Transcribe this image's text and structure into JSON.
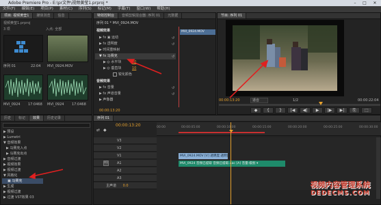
{
  "window": {
    "title": "Adobe Premiere Pro - E:\\pr文件\\视频黄莹1.prproj *",
    "buttons": [
      "–",
      "□",
      "✕"
    ]
  },
  "menu": [
    "文件(F)",
    "编辑(E)",
    "项目(P)",
    "素材(C)",
    "序列(S)",
    "标记(M)",
    "字幕(T)",
    "窗口(W)",
    "帮助(H)"
  ],
  "project": {
    "tabs": [
      "项目: 视频黄莹1",
      "媒体浏览",
      "信息",
      "效果"
    ],
    "file_name": "视频黄莹1.prproj",
    "item_count": "3 项",
    "in_point": "入点: 全部",
    "items": [
      {
        "name": "序列 01",
        "duration": "22:04"
      },
      {
        "name": "MVI_0924.MOV",
        "duration": "22:04"
      },
      {
        "name": "MVI_0924",
        "duration": "17:0468"
      },
      {
        "name": "MVI_0924",
        "duration": "17:0468"
      }
    ]
  },
  "effect_controls": {
    "tabs": [
      "特效控制台",
      "音频剪辑混合器: 序列 01",
      "元数据"
    ],
    "clip_title": "序列 01 * MVI_0924.MOV",
    "mini_clip": "MVI_0924.MOV",
    "sections": [
      {
        "label": "视频效果"
      },
      {
        "label": "▶ fx ▣ 运动"
      },
      {
        "label": "▶ fx 透明度"
      },
      {
        "label": "▶ 时间重映射"
      },
      {
        "label": "▼ fx 马赛克"
      },
      {
        "label": "▶ ◎ 水平块"
      },
      {
        "label": "▶ ◎ 垂直块"
      },
      {
        "label": "锐化颜色"
      },
      {
        "label": "音频效果"
      },
      {
        "label": "▶ fx 音量"
      },
      {
        "label": "▶ fx 声道音量"
      },
      {
        "label": "▶ 声像器"
      }
    ],
    "values": [
      "10",
      "10"
    ],
    "timecode": "00:00:13:20"
  },
  "program": {
    "tab": "节目: 序列 01",
    "timecode_left": "00:00:13:20",
    "fit": "适合",
    "timecode_right": "00:00:22:04",
    "ratio": "1/2",
    "transport": [
      "◆",
      "{",
      "}",
      "|◀",
      "◀|",
      "▶",
      "|▶",
      "▶|",
      "⎘",
      "⬚",
      "▣"
    ]
  },
  "history": {
    "tabs": [
      "历史",
      "标记",
      "效果",
      "历史记录"
    ],
    "items": [
      "▶ 预设",
      "▶ Lumetri",
      "▼ 音频效果",
      "  ▶ 马赛克入点",
      "  ▶ 马赛克出点",
      "▶ 音频过渡",
      "▶ 视频效果",
      "▶ 视频过渡",
      "▼ 风格化",
      "  ▣ 马赛克",
      "▶ 生成",
      "▶ 视频过渡",
      "▶ 过渡 VST效果 03"
    ]
  },
  "timeline": {
    "tab": "序列 01",
    "timecode": "00:00:13:20",
    "ruler": [
      "00:00",
      "00:00:05:00",
      "00:00:10:00",
      "00:00:15:00",
      "00:00:20:00",
      "00:00:25:00",
      "00:00:30:00"
    ],
    "tracks": [
      {
        "id": "V3",
        "label": "V3"
      },
      {
        "id": "V2",
        "label": "V2"
      },
      {
        "id": "V1",
        "label": "V1"
      },
      {
        "id": "A1",
        "label": "A1"
      },
      {
        "id": "A2",
        "label": "A2"
      },
      {
        "id": "A3",
        "label": "A3"
      },
      {
        "id": "master",
        "label": "主声道",
        "value": "0.0"
      }
    ],
    "video_clip": "MVI_0924.MOV [V] 透明度:透明度 ▾",
    "audio_clip": "MVI_0924 音频已提取 音频已提取.aac [A] 音量:级别 ▾"
  },
  "watermark": {
    "line1": "视频内容管理系统",
    "line2": "DEDECMS.COM"
  },
  "colors": {
    "accent": "#e8a22e",
    "video_clip": "#8bb0d6",
    "audio_clip": "#1e8a6a",
    "arrow": "#e02020"
  }
}
